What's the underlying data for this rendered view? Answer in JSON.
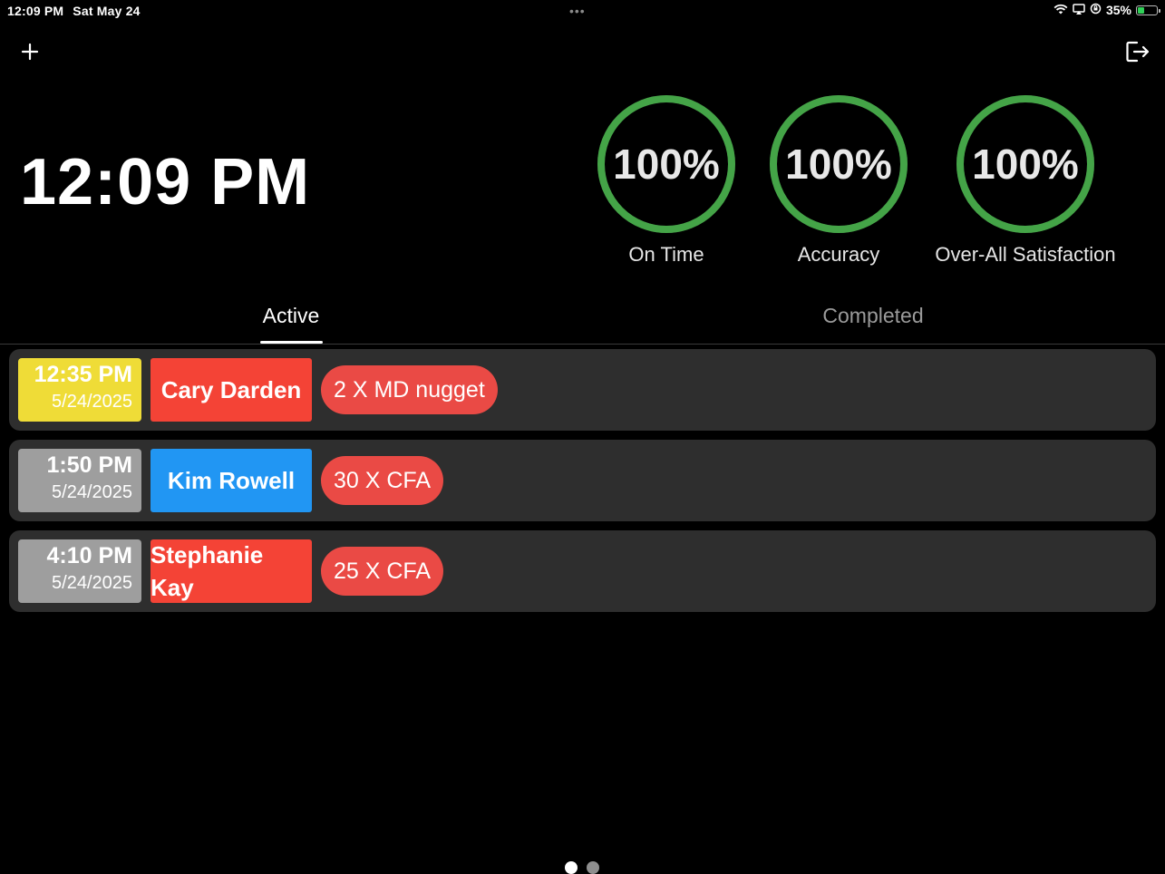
{
  "status_bar": {
    "time": "12:09 PM",
    "date": "Sat May 24",
    "dots": "•••",
    "battery_percent": "35%",
    "battery_level": 0.35
  },
  "toolbar": {
    "add_icon": "plus-icon",
    "logout_icon": "logout-icon"
  },
  "clock": {
    "time": "12:09 PM"
  },
  "metrics": [
    {
      "value": "100%",
      "label": "On Time",
      "level": 1.0
    },
    {
      "value": "100%",
      "label": "Accuracy",
      "level": 1.0
    },
    {
      "value": "100%",
      "label": "Over-All Satisfaction",
      "level": 1.0
    }
  ],
  "metric_color": "#44a447",
  "tabs": [
    {
      "label": "Active",
      "selected": true
    },
    {
      "label": "Completed",
      "selected": false
    }
  ],
  "orders": [
    {
      "time": "12:35 PM",
      "date": "5/24/2025",
      "time_color": "#efdc37",
      "name": "Cary Darden",
      "name_color": "#f44336",
      "item": "2 X MD nugget"
    },
    {
      "time": "1:50 PM",
      "date": "5/24/2025",
      "time_color": "#9e9e9e",
      "name": "Kim Rowell",
      "name_color": "#2196f3",
      "item": "30 X CFA"
    },
    {
      "time": "4:10 PM",
      "date": "5/24/2025",
      "time_color": "#9e9e9e",
      "name": "Stephanie Kay",
      "name_color": "#f44336",
      "item": "25 X CFA"
    }
  ],
  "pager": {
    "count": 2,
    "current": 1
  }
}
